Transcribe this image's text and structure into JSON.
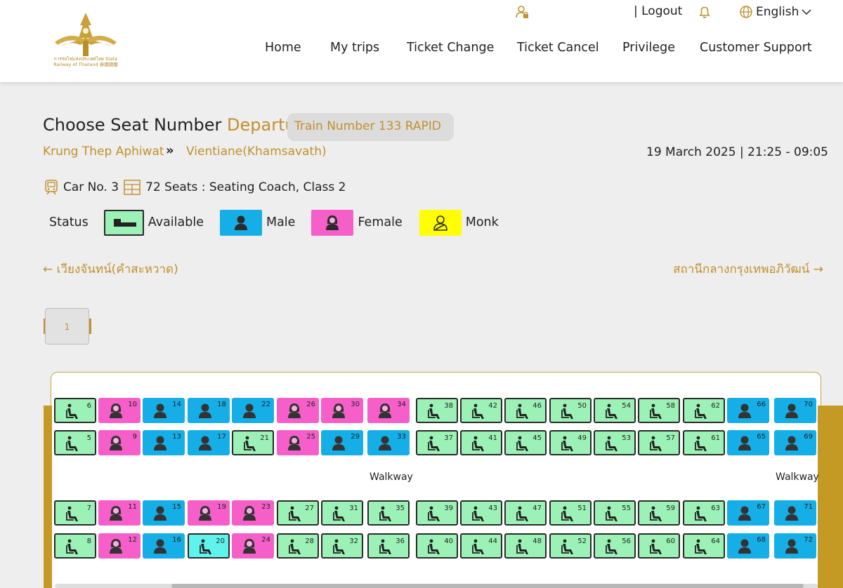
{
  "header": {
    "logo_text": "การรถไฟแห่งประเทศไทย State Railway of Thailand 泰國國鐵",
    "logout": "| Logout",
    "language": "English",
    "nav": [
      "Home",
      "My trips",
      "Ticket Change",
      "Ticket Cancel",
      "Privilege",
      "Customer Support"
    ]
  },
  "title": {
    "main": "Choose Seat Number",
    "direction": "Departure",
    "train": "Train Number  133   RAPID"
  },
  "route": {
    "origin": "Krung Thep Aphiwat",
    "arrow": "»",
    "destination": "Vientiane(Khamsavath)",
    "datetime": "19 March 2025 | 21:25 - 09:05"
  },
  "car": {
    "number": "Car No. 3",
    "seats": "72 Seats : Seating Coach, Class 2"
  },
  "legend": {
    "label": "Status",
    "available": "Available",
    "male": "Male",
    "female": "Female",
    "monk": "Monk"
  },
  "directions": {
    "left": "เวียงจันทน์(คำสะหวาด)",
    "right": "สถานีกลางกรุงเทพอภิวัฒน์"
  },
  "car_tab": "1",
  "walkway_label": "Walkway",
  "colors": {
    "gold": "#c0902d",
    "available": "#9cf2b6",
    "male": "#16aee6",
    "female": "#f65fc9",
    "monk": "#ffff00",
    "selected": "#5ff3ee"
  },
  "seat_rows": [
    [
      [
        "6",
        "available"
      ],
      [
        "10",
        "female"
      ],
      [
        "14",
        "male"
      ],
      [
        "18",
        "male"
      ],
      [
        "22",
        "male"
      ],
      [
        "26",
        "female"
      ],
      [
        "30",
        "female"
      ],
      [
        "34",
        "female"
      ],
      [
        "38",
        "available"
      ],
      [
        "42",
        "available"
      ],
      [
        "46",
        "available"
      ],
      [
        "50",
        "available"
      ],
      [
        "54",
        "available"
      ],
      [
        "58",
        "available"
      ],
      [
        "62",
        "available"
      ],
      [
        "66",
        "male"
      ],
      [
        "70",
        "male"
      ]
    ],
    [
      [
        "5",
        "available"
      ],
      [
        "9",
        "female"
      ],
      [
        "13",
        "male"
      ],
      [
        "17",
        "male"
      ],
      [
        "21",
        "available"
      ],
      [
        "25",
        "female"
      ],
      [
        "29",
        "male"
      ],
      [
        "33",
        "male"
      ],
      [
        "37",
        "available"
      ],
      [
        "41",
        "available"
      ],
      [
        "45",
        "available"
      ],
      [
        "49",
        "available"
      ],
      [
        "53",
        "available"
      ],
      [
        "57",
        "available"
      ],
      [
        "61",
        "available"
      ],
      [
        "65",
        "male"
      ],
      [
        "69",
        "male"
      ]
    ],
    [
      [
        "7",
        "available"
      ],
      [
        "11",
        "female"
      ],
      [
        "15",
        "male"
      ],
      [
        "19",
        "female"
      ],
      [
        "23",
        "female"
      ],
      [
        "27",
        "available"
      ],
      [
        "31",
        "available"
      ],
      [
        "35",
        "available"
      ],
      [
        "39",
        "available"
      ],
      [
        "43",
        "available"
      ],
      [
        "47",
        "available"
      ],
      [
        "51",
        "available"
      ],
      [
        "55",
        "available"
      ],
      [
        "59",
        "available"
      ],
      [
        "63",
        "available"
      ],
      [
        "67",
        "male"
      ],
      [
        "71",
        "male"
      ]
    ],
    [
      [
        "8",
        "available"
      ],
      [
        "12",
        "female"
      ],
      [
        "16",
        "male"
      ],
      [
        "20",
        "selected"
      ],
      [
        "24",
        "female"
      ],
      [
        "28",
        "available"
      ],
      [
        "32",
        "available"
      ],
      [
        "36",
        "available"
      ],
      [
        "40",
        "available"
      ],
      [
        "44",
        "available"
      ],
      [
        "48",
        "available"
      ],
      [
        "52",
        "available"
      ],
      [
        "56",
        "available"
      ],
      [
        "60",
        "available"
      ],
      [
        "64",
        "available"
      ],
      [
        "68",
        "male"
      ],
      [
        "72",
        "male"
      ]
    ]
  ]
}
